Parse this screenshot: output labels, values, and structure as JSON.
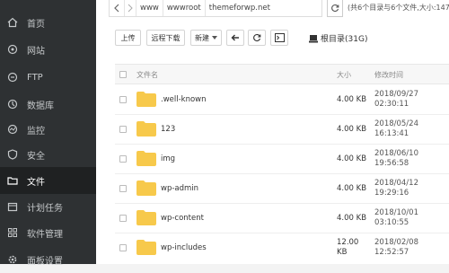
{
  "sidebar": {
    "items": [
      {
        "label": "首页",
        "icon": "home-icon"
      },
      {
        "label": "网站",
        "icon": "globe-icon"
      },
      {
        "label": "FTP",
        "icon": "ftp-icon"
      },
      {
        "label": "数据库",
        "icon": "database-icon"
      },
      {
        "label": "监控",
        "icon": "monitor-icon"
      },
      {
        "label": "安全",
        "icon": "shield-icon"
      },
      {
        "label": "文件",
        "icon": "folder-icon"
      },
      {
        "label": "计划任务",
        "icon": "calendar-icon"
      },
      {
        "label": "软件管理",
        "icon": "grid-icon"
      },
      {
        "label": "面板设置",
        "icon": "gear-icon"
      }
    ],
    "active": "文件",
    "bg_color": "#2e3133"
  },
  "pathbar": {
    "crumbs": [
      "www",
      "wwwroot",
      "themeforwp.net"
    ],
    "summary": "(共6个目录与6个文件,大小:147"
  },
  "toolbar": {
    "upload": "上传",
    "remote_download": "远程下载",
    "new": "新建",
    "root_dir": "根目录(31G)"
  },
  "table": {
    "headers": {
      "name": "文件名",
      "size": "大小",
      "modified": "修改时间"
    },
    "rows": [
      {
        "name": ".well-known",
        "size": "4.00 KB",
        "date": "2018/09/27",
        "time": "02:30:11"
      },
      {
        "name": "123",
        "size": "4.00 KB",
        "date": "2018/05/24",
        "time": "16:13:41"
      },
      {
        "name": "img",
        "size": "4.00 KB",
        "date": "2018/06/10",
        "time": "19:56:58"
      },
      {
        "name": "wp-admin",
        "size": "4.00 KB",
        "date": "2018/04/12",
        "time": "19:29:16"
      },
      {
        "name": "wp-content",
        "size": "4.00 KB",
        "date": "2018/10/01",
        "time": "03:10:55"
      },
      {
        "name": "wp-includes",
        "size": "12.00",
        "size2": "KB",
        "date": "2018/02/08",
        "time": "12:52:57"
      }
    ]
  },
  "colors": {
    "folder": "#f7c94b",
    "accent": "#20a53a"
  }
}
